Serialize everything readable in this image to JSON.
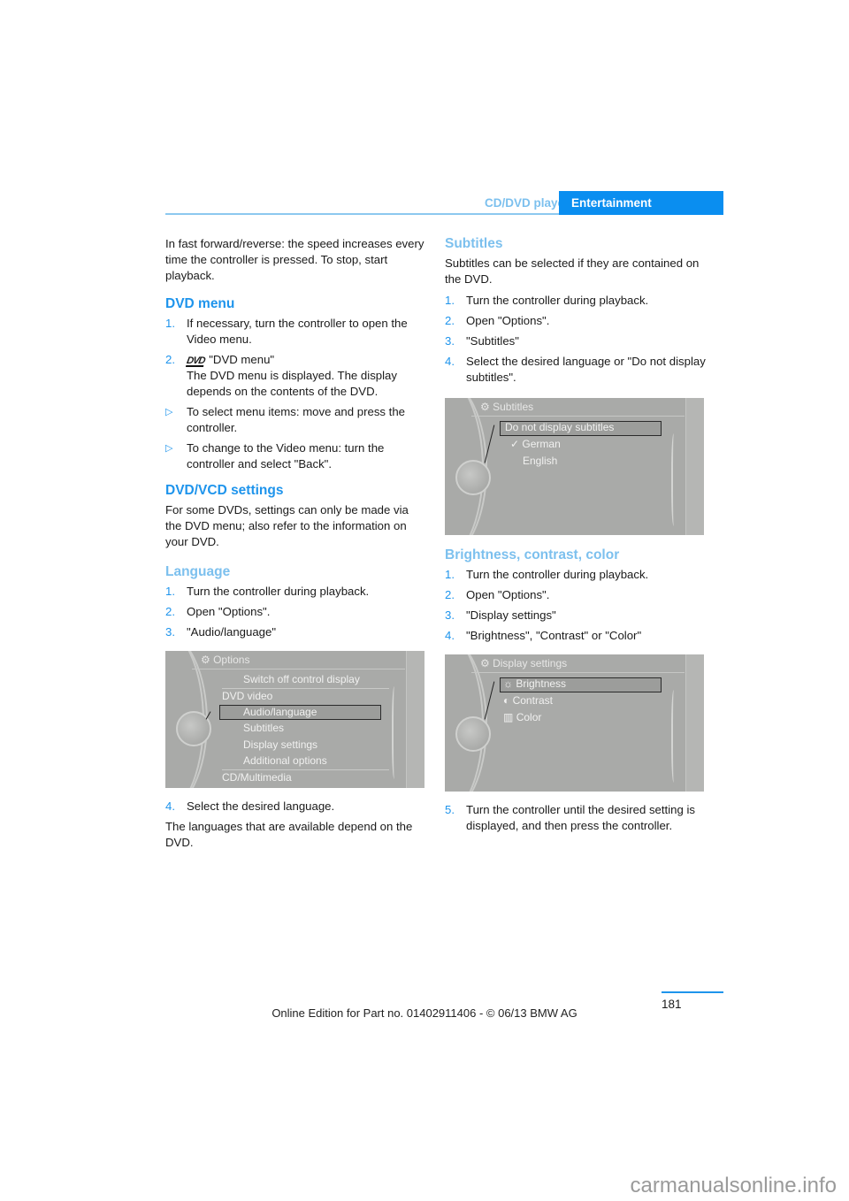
{
  "header": {
    "section": "CD/DVD player",
    "chapter": "Entertainment"
  },
  "left": {
    "intro": "In fast forward/reverse: the speed increases every time the controller is pressed. To stop, start playback.",
    "dvd_menu": {
      "heading": "DVD menu",
      "steps": [
        {
          "num": "1.",
          "text": "If necessary, turn the controller to open the Video menu."
        },
        {
          "num": "2.",
          "icon": "dvd-icon",
          "text": "\"DVD menu\"",
          "text2": "The DVD menu is displayed. The display depends on the contents of the DVD."
        }
      ],
      "bullets": [
        "To select menu items: move and press the controller.",
        "To change to the Video menu: turn the controller and select \"Back\"."
      ],
      "bullet_glyph": "▷"
    },
    "settings": {
      "heading": "DVD/VCD settings",
      "text": "For some DVDs, settings can only be made via the DVD menu; also refer to the information on your DVD."
    },
    "language": {
      "heading": "Language",
      "steps": [
        {
          "num": "1.",
          "text": "Turn the controller during playback."
        },
        {
          "num": "2.",
          "text": "Open \"Options\"."
        },
        {
          "num": "3.",
          "text": "\"Audio/language\""
        }
      ],
      "screen": {
        "title": "Options",
        "items": [
          "Switch off control display",
          "DVD video",
          "Audio/language",
          "Subtitles",
          "Display settings",
          "Additional options",
          "CD/Multimedia"
        ],
        "selected": "Audio/language"
      },
      "step4": {
        "num": "4.",
        "text": "Select the desired language."
      },
      "note": "The languages that are available depend on the DVD."
    }
  },
  "right": {
    "subtitles": {
      "heading": "Subtitles",
      "text": "Subtitles can be selected if they are contained on the DVD.",
      "steps": [
        {
          "num": "1.",
          "text": "Turn the controller during playback."
        },
        {
          "num": "2.",
          "text": "Open \"Options\"."
        },
        {
          "num": "3.",
          "text": "\"Subtitles\""
        },
        {
          "num": "4.",
          "text": "Select the desired language or \"Do not display subtitles\"."
        }
      ],
      "screen": {
        "title": "Subtitles",
        "items": [
          "Do not display subtitles",
          "German",
          "English"
        ],
        "selected": "Do not display subtitles",
        "checked": "German",
        "check_glyph": "✓"
      }
    },
    "display": {
      "heading": "Brightness, contrast, color",
      "steps": [
        {
          "num": "1.",
          "text": "Turn the controller during playback."
        },
        {
          "num": "2.",
          "text": "Open \"Options\"."
        },
        {
          "num": "3.",
          "text": "\"Display settings\""
        },
        {
          "num": "4.",
          "text": "\"Brightness\", \"Contrast\" or \"Color\""
        }
      ],
      "screen": {
        "title": "Display settings",
        "items": [
          {
            "icon": "☼",
            "label": "Brightness"
          },
          {
            "icon": "◐",
            "label": "Contrast"
          },
          {
            "icon": "▥",
            "label": "Color"
          }
        ],
        "selected": "Brightness"
      },
      "step5": {
        "num": "5.",
        "text": "Turn the controller until the desired setting is displayed, and then press the controller."
      }
    }
  },
  "page_number": "181",
  "footer": "Online Edition for Part no. 01402911406 - © 06/13 BMW AG",
  "watermark": "carmanualsonline.info"
}
